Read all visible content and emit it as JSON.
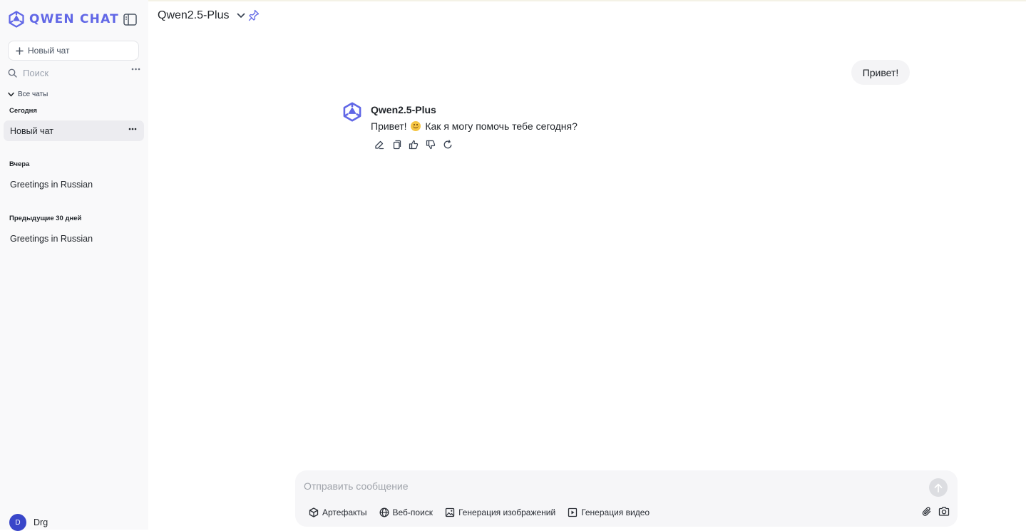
{
  "app": {
    "brand": "QWEN CHAT",
    "brand_color": "#6167e6"
  },
  "sidebar": {
    "new_chat_label": "Новый чат",
    "search_placeholder": "Поиск",
    "all_chats_label": "Все чаты",
    "sections": [
      {
        "label": "Сегодня",
        "items": [
          {
            "label": "Новый чат",
            "active": true
          }
        ]
      },
      {
        "label": "Вчера",
        "items": [
          {
            "label": "Greetings in Russian"
          }
        ]
      },
      {
        "label": "Предыдущие 30 дней",
        "items": [
          {
            "label": "Greetings in Russian"
          }
        ]
      }
    ],
    "user": {
      "initial": "D",
      "name": "Drg",
      "avatar_color": "#3946c9"
    }
  },
  "header": {
    "model_name": "Qwen2.5-Plus"
  },
  "conversation": {
    "user_message": "Привет!",
    "assistant": {
      "name": "Qwen2.5-Plus",
      "text_before_emoji": "Привет!",
      "text_after_emoji": "Как я могу помочь тебе сегодня?"
    },
    "actions": [
      "edit-icon",
      "copy-icon",
      "thumbs-up-icon",
      "thumbs-down-icon",
      "regenerate-icon"
    ]
  },
  "composer": {
    "placeholder": "Отправить сообщение",
    "tools": {
      "artifacts": "Артефакты",
      "web_search": "Веб-поиск",
      "image_generation": "Генерация изображений",
      "video_generation": "Генерация видео"
    }
  }
}
